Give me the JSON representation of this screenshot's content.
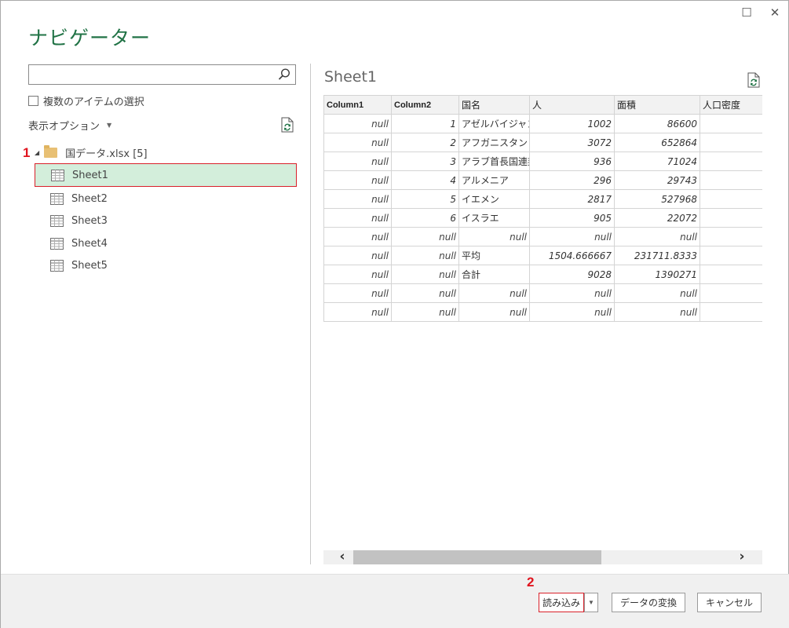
{
  "window": {
    "title": "ナビゲーター",
    "maximize_glyph": "☐",
    "close_glyph": "✕"
  },
  "left_pane": {
    "search": {
      "value": "",
      "placeholder": ""
    },
    "multi_select_label": "複数のアイテムの選択",
    "display_options_label": "表示オプション",
    "step_marker": "1",
    "tree": {
      "root_label": "国データ.xlsx [5]",
      "items": [
        {
          "label": "Sheet1",
          "selected": true
        },
        {
          "label": "Sheet2",
          "selected": false
        },
        {
          "label": "Sheet3",
          "selected": false
        },
        {
          "label": "Sheet4",
          "selected": false
        },
        {
          "label": "Sheet5",
          "selected": false
        }
      ]
    }
  },
  "preview": {
    "title": "Sheet1",
    "columns": [
      "Column1",
      "Column2",
      "国名",
      "人",
      "面積",
      "人口密度"
    ],
    "rows": [
      [
        "null",
        "1",
        "アゼルバイジャン",
        "1002",
        "86600",
        ""
      ],
      [
        "null",
        "2",
        "アフガニスタン",
        "3072",
        "652864",
        ""
      ],
      [
        "null",
        "3",
        "アラブ首長国連邦",
        "936",
        "71024",
        ""
      ],
      [
        "null",
        "4",
        "アルメニア",
        "296",
        "29743",
        ""
      ],
      [
        "null",
        "5",
        "イエメン",
        "2817",
        "527968",
        ""
      ],
      [
        "null",
        "6",
        "イスラエ",
        "905",
        "22072",
        ""
      ],
      [
        "null",
        "null",
        "null",
        "null",
        "null",
        ""
      ],
      [
        "null",
        "null",
        "平均",
        "1504.666667",
        "231711.8333",
        ""
      ],
      [
        "null",
        "null",
        "合計",
        "9028",
        "1390271",
        ""
      ],
      [
        "null",
        "null",
        "null",
        "null",
        "null",
        ""
      ],
      [
        "null",
        "null",
        "null",
        "null",
        "null",
        ""
      ]
    ]
  },
  "footer": {
    "step_marker": "2",
    "load_label": "読み込み",
    "transform_label": "データの変換",
    "cancel_label": "キャンセル"
  },
  "colors": {
    "accent_green": "#217346",
    "selection_bg": "#d3eedb",
    "highlight_red": "#d9202a"
  }
}
